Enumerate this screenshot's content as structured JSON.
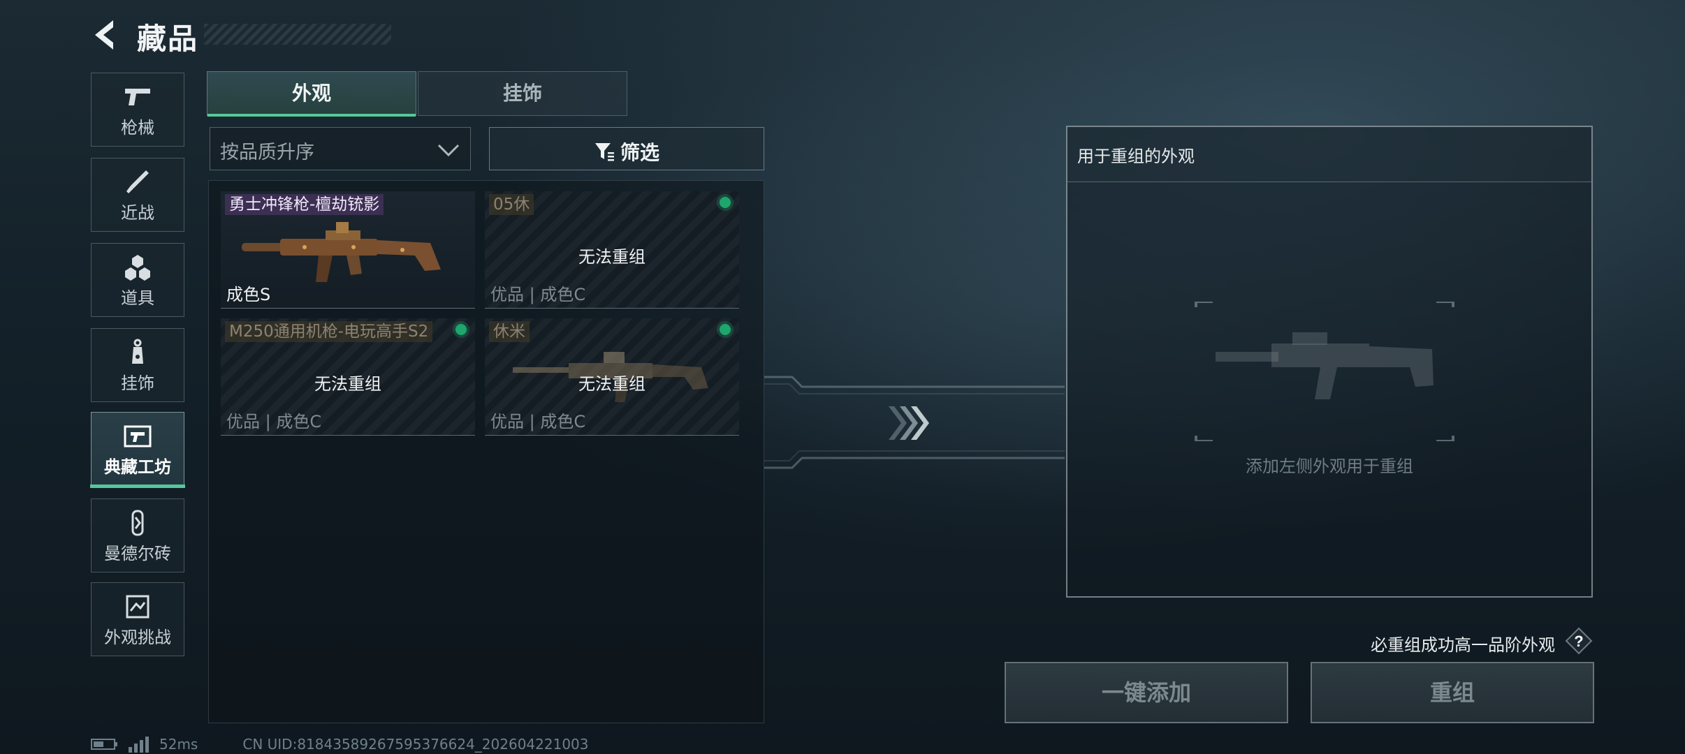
{
  "header": {
    "title": "藏品",
    "back_icon": "back-arrow-icon"
  },
  "sidebar": {
    "items": [
      {
        "label": "枪械",
        "icon": "pistol-icon"
      },
      {
        "label": "近战",
        "icon": "knife-icon"
      },
      {
        "label": "道具",
        "icon": "cubes-icon"
      },
      {
        "label": "挂饰",
        "icon": "charm-icon"
      },
      {
        "label": "典藏工坊",
        "icon": "workshop-icon",
        "active": true
      },
      {
        "label": "曼德尔砖",
        "icon": "brick-icon"
      },
      {
        "label": "外观挑战",
        "icon": "challenge-icon"
      }
    ]
  },
  "tabs": [
    {
      "label": "外观",
      "active": true
    },
    {
      "label": "挂饰",
      "active": false
    }
  ],
  "sort": {
    "label": "按品质升序"
  },
  "filter": {
    "label": "筛选"
  },
  "cards": [
    {
      "name": "勇士冲锋枪-檀劫铳影",
      "grade": "成色S",
      "status": ""
    },
    {
      "name": "05休",
      "grade": "优品 | 成色C",
      "status": "无法重组"
    },
    {
      "name": "M250通用机枪-电玩高手S2",
      "grade": "优品 | 成色C",
      "status": "无法重组"
    },
    {
      "name": "休米",
      "grade": "优品 | 成色C",
      "status": "无法重组"
    }
  ],
  "recompose": {
    "header": "用于重组的外观",
    "placeholder": "添加左侧外观用于重组",
    "note": "必重组成功高一品阶外观",
    "add_button": "一键添加",
    "recompose_button": "重组"
  },
  "footer": {
    "ping": "52ms",
    "uid": "CN UID:818435892675953766​24_202604221003"
  },
  "colors": {
    "accent": "#57c79a",
    "online_dot": "#1ea66c",
    "legend_purple": "#3b2f52"
  }
}
